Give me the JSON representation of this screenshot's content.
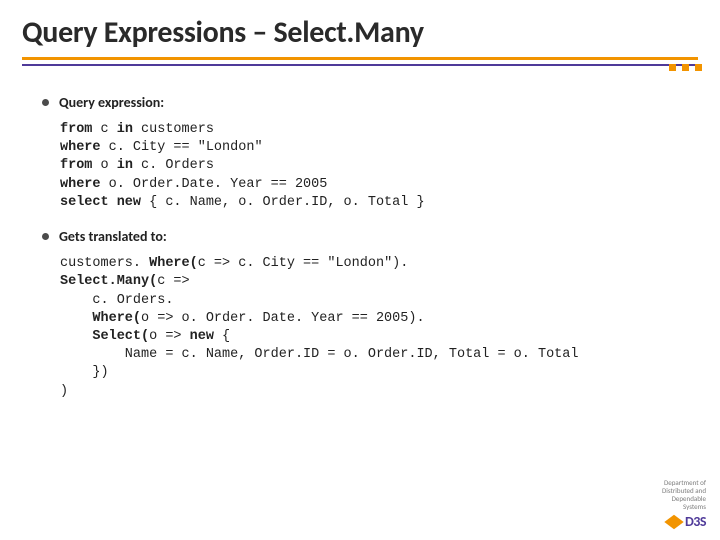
{
  "title": "Query Expressions – Select.Many",
  "bullets": {
    "b1": "Query expression:",
    "b2": "Gets translated to:"
  },
  "code1": {
    "l1a": "from",
    "l1b": " c ",
    "l1c": "in",
    "l1d": " customers",
    "l2a": "where",
    "l2b": " c. City == \"London\"",
    "l3a": "from",
    "l3b": " o ",
    "l3c": "in",
    "l3d": " c. Orders",
    "l4a": "where",
    "l4b": " o. Order.Date. Year == 2005",
    "l5a": "select new",
    "l5b": " { c. Name, o. Order.ID, o. Total }"
  },
  "code2": {
    "l1a": "customers. ",
    "l1b": "Where(",
    "l1c": "c => c. City == \"London\").",
    "l2a": "Select.Many(",
    "l2b": "c =>",
    "l3": "    c. Orders.",
    "l4a": "    ",
    "l4b": "Where(",
    "l4c": "o => o. Order. Date. Year == 2005).",
    "l5a": "    ",
    "l5b": "Select(",
    "l5c": "o => ",
    "l5d": "new",
    "l5e": " {",
    "l6": "        Name = c. Name, Order.ID = o. Order.ID, Total = o. Total",
    "l7": "    })",
    "l8": ")"
  },
  "footer": {
    "dept1": "Department of",
    "dept2": "Distributed and",
    "dept3": "Dependable",
    "dept4": "Systems",
    "logo": "D3S"
  }
}
